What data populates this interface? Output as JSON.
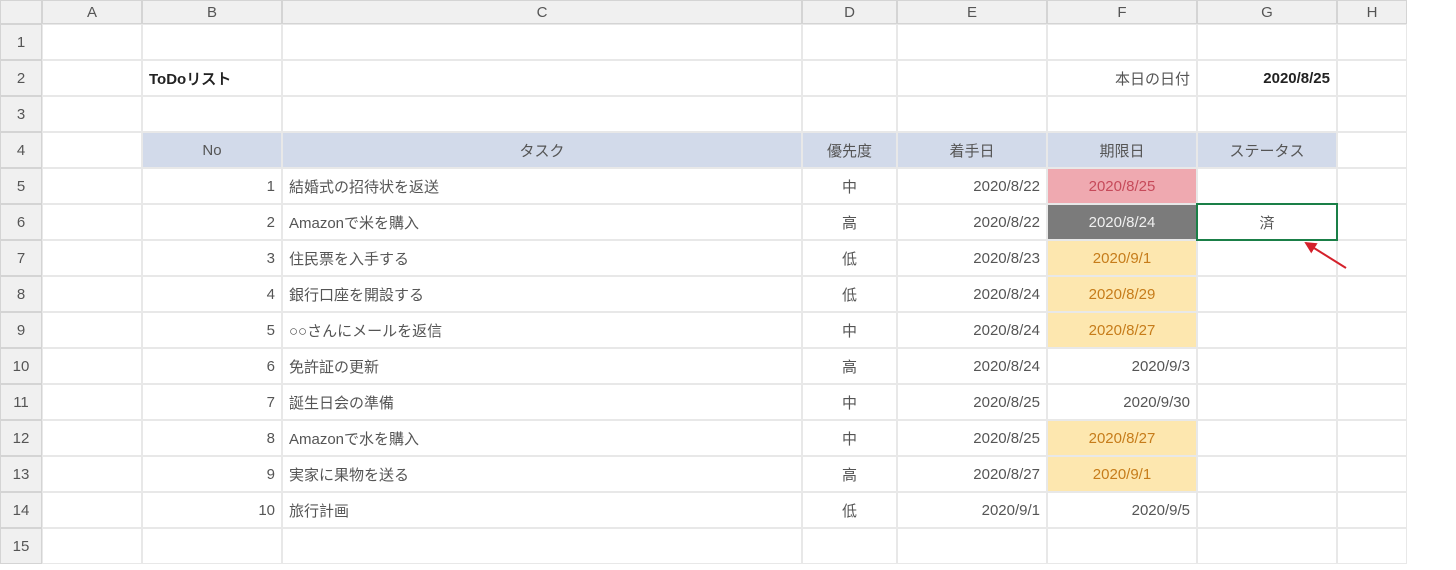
{
  "columns": [
    "A",
    "B",
    "C",
    "D",
    "E",
    "F",
    "G",
    "H"
  ],
  "rowCount": 15,
  "title": "ToDoリスト",
  "todayLabel": "本日の日付",
  "todayDate": "2020/8/25",
  "headers": {
    "no": "No",
    "task": "タスク",
    "priority": "優先度",
    "start": "着手日",
    "deadline": "期限日",
    "status": "ステータス"
  },
  "selectedStatus": "済",
  "rows": [
    {
      "no": 1,
      "task": "結婚式の招待状を返送",
      "priority": "中",
      "start": "2020/8/22",
      "deadline": "2020/8/25",
      "deadlineClass": "deadline-fill-red",
      "status": ""
    },
    {
      "no": 2,
      "task": "Amazonで米を購入",
      "priority": "高",
      "start": "2020/8/22",
      "deadline": "2020/8/24",
      "deadlineClass": "deadline-fill-gray",
      "status": "済"
    },
    {
      "no": 3,
      "task": "住民票を入手する",
      "priority": "低",
      "start": "2020/8/23",
      "deadline": "2020/9/1",
      "deadlineClass": "deadline-fill-amber",
      "status": ""
    },
    {
      "no": 4,
      "task": "銀行口座を開設する",
      "priority": "低",
      "start": "2020/8/24",
      "deadline": "2020/8/29",
      "deadlineClass": "deadline-fill-amber",
      "status": ""
    },
    {
      "no": 5,
      "task": "○○さんにメールを返信",
      "priority": "中",
      "start": "2020/8/24",
      "deadline": "2020/8/27",
      "deadlineClass": "deadline-fill-amber",
      "status": ""
    },
    {
      "no": 6,
      "task": "免許証の更新",
      "priority": "高",
      "start": "2020/8/24",
      "deadline": "2020/9/3",
      "deadlineClass": "",
      "status": ""
    },
    {
      "no": 7,
      "task": "誕生日会の準備",
      "priority": "中",
      "start": "2020/8/25",
      "deadline": "2020/9/30",
      "deadlineClass": "",
      "status": ""
    },
    {
      "no": 8,
      "task": "Amazonで水を購入",
      "priority": "中",
      "start": "2020/8/25",
      "deadline": "2020/8/27",
      "deadlineClass": "deadline-fill-amber",
      "status": ""
    },
    {
      "no": 9,
      "task": "実家に果物を送る",
      "priority": "高",
      "start": "2020/8/27",
      "deadline": "2020/9/1",
      "deadlineClass": "deadline-fill-amber",
      "status": ""
    },
    {
      "no": 10,
      "task": "旅行計画",
      "priority": "低",
      "start": "2020/9/1",
      "deadline": "2020/9/5",
      "deadlineClass": "",
      "status": ""
    }
  ]
}
